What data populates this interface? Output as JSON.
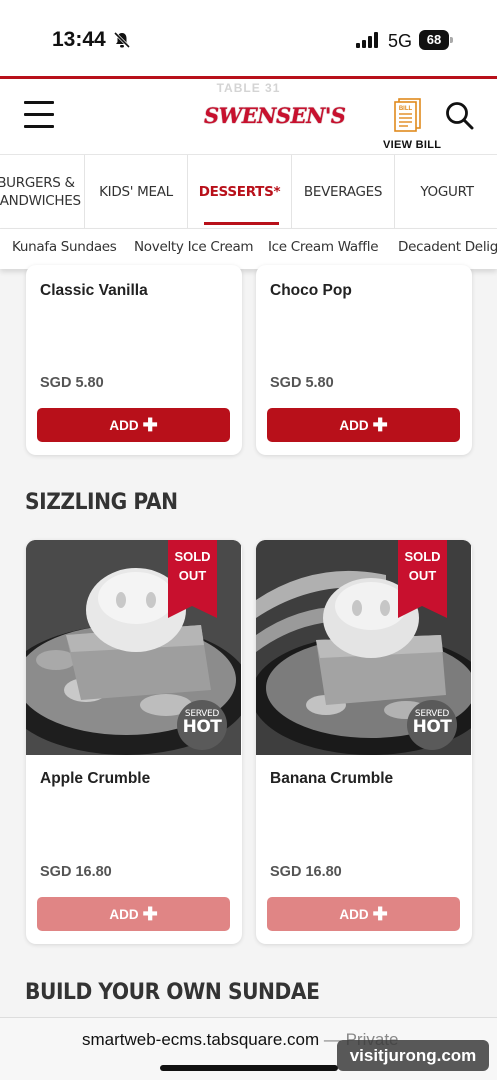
{
  "status": {
    "time": "13:44",
    "network": "5G",
    "battery": "68"
  },
  "header": {
    "table_label": "TABLE 31",
    "logo": "SWENSEN'S",
    "view_bill": "VIEW BILL",
    "bill_icon_label": "BILL"
  },
  "categories": [
    {
      "label": "BURGERS & SANDWICHES"
    },
    {
      "label": "KIDS' MEAL"
    },
    {
      "label": "DESSERTS*",
      "active": true
    },
    {
      "label": "BEVERAGES"
    },
    {
      "label": "YOGURT"
    }
  ],
  "subcategories": [
    {
      "label": "Kunafa Sundaes"
    },
    {
      "label": "Novelty Ice Cream"
    },
    {
      "label": "Ice Cream Waffle"
    },
    {
      "label": "Decadent Delights"
    }
  ],
  "top_items": [
    {
      "name": "Classic Vanilla",
      "price": "SGD 5.80",
      "button": "ADD"
    },
    {
      "name": "Choco Pop",
      "price": "SGD 5.80",
      "button": "ADD"
    }
  ],
  "sections": {
    "sizzling_pan": "SIZZLING PAN",
    "build_sundae": "BUILD YOUR OWN SUNDAE"
  },
  "sizzling_items": [
    {
      "name": "Apple Crumble",
      "price": "SGD 16.80",
      "button": "ADD",
      "sold_out": "SOLD OUT",
      "badge_small": "SERVED",
      "badge_big": "HOT"
    },
    {
      "name": "Banana Crumble",
      "price": "SGD 16.80",
      "button": "ADD",
      "sold_out": "SOLD OUT",
      "badge_small": "SERVED",
      "badge_big": "HOT"
    }
  ],
  "browser": {
    "url": "smartweb-ecms.tabsquare.com",
    "private_label": "— Private"
  },
  "watermark": "visitjurong.com",
  "colors": {
    "brand_red": "#b8101a",
    "disabled_red": "#e08585"
  },
  "icons": [
    "bell-slash-icon",
    "signal-icon",
    "battery-icon",
    "menu-icon",
    "bill-icon",
    "search-icon",
    "plus-icon"
  ]
}
